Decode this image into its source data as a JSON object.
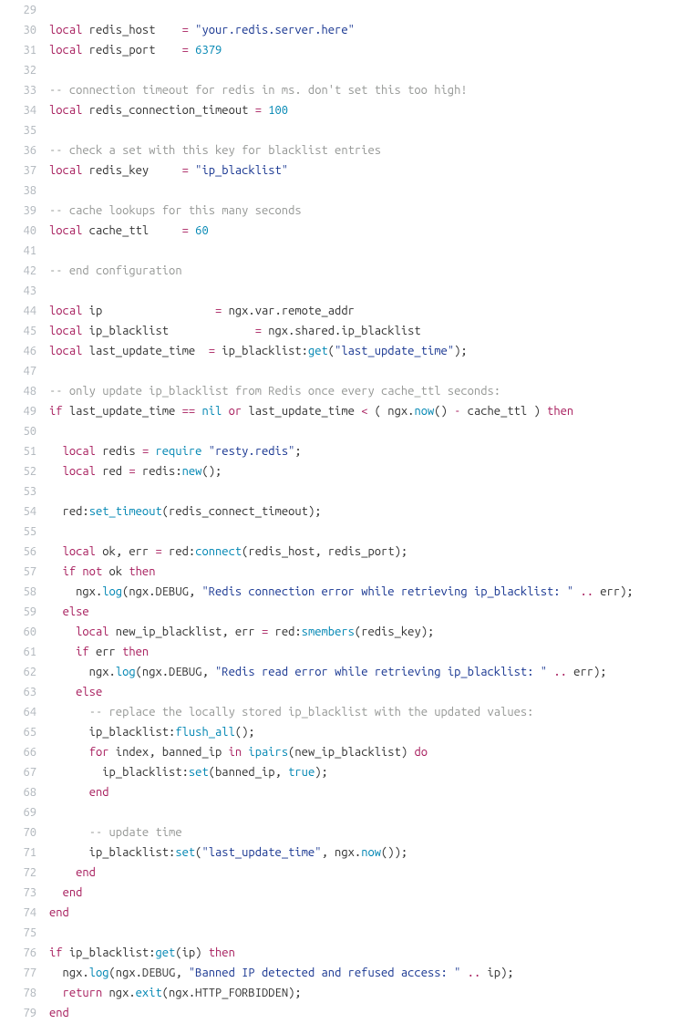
{
  "lines": [
    {
      "n": "29",
      "tokens": []
    },
    {
      "n": "30",
      "tokens": [
        {
          "c": "kw",
          "t": "local"
        },
        {
          "c": "id",
          "t": " redis_host    "
        },
        {
          "c": "kw",
          "t": "="
        },
        {
          "c": "id",
          "t": " "
        },
        {
          "c": "str",
          "t": "\"your.redis.server.here\""
        }
      ]
    },
    {
      "n": "31",
      "tokens": [
        {
          "c": "kw",
          "t": "local"
        },
        {
          "c": "id",
          "t": " redis_port    "
        },
        {
          "c": "kw",
          "t": "="
        },
        {
          "c": "id",
          "t": " "
        },
        {
          "c": "num",
          "t": "6379"
        }
      ]
    },
    {
      "n": "32",
      "tokens": []
    },
    {
      "n": "33",
      "tokens": [
        {
          "c": "cm",
          "t": "-- connection timeout for redis in ms. don't set this too high!"
        }
      ]
    },
    {
      "n": "34",
      "tokens": [
        {
          "c": "kw",
          "t": "local"
        },
        {
          "c": "id",
          "t": " redis_connection_timeout "
        },
        {
          "c": "kw",
          "t": "="
        },
        {
          "c": "id",
          "t": " "
        },
        {
          "c": "num",
          "t": "100"
        }
      ]
    },
    {
      "n": "35",
      "tokens": []
    },
    {
      "n": "36",
      "tokens": [
        {
          "c": "cm",
          "t": "-- check a set with this key for blacklist entries"
        }
      ]
    },
    {
      "n": "37",
      "tokens": [
        {
          "c": "kw",
          "t": "local"
        },
        {
          "c": "id",
          "t": " redis_key     "
        },
        {
          "c": "kw",
          "t": "="
        },
        {
          "c": "id",
          "t": " "
        },
        {
          "c": "str",
          "t": "\"ip_blacklist\""
        }
      ]
    },
    {
      "n": "38",
      "tokens": []
    },
    {
      "n": "39",
      "tokens": [
        {
          "c": "cm",
          "t": "-- cache lookups for this many seconds"
        }
      ]
    },
    {
      "n": "40",
      "tokens": [
        {
          "c": "kw",
          "t": "local"
        },
        {
          "c": "id",
          "t": " cache_ttl     "
        },
        {
          "c": "kw",
          "t": "="
        },
        {
          "c": "id",
          "t": " "
        },
        {
          "c": "num",
          "t": "60"
        }
      ]
    },
    {
      "n": "41",
      "tokens": []
    },
    {
      "n": "42",
      "tokens": [
        {
          "c": "cm",
          "t": "-- end configuration"
        }
      ]
    },
    {
      "n": "43",
      "tokens": []
    },
    {
      "n": "44",
      "tokens": [
        {
          "c": "kw",
          "t": "local"
        },
        {
          "c": "id",
          "t": " ip                 "
        },
        {
          "c": "kw",
          "t": "="
        },
        {
          "c": "id",
          "t": " ngx.var.remote_addr"
        }
      ]
    },
    {
      "n": "45",
      "tokens": [
        {
          "c": "kw",
          "t": "local"
        },
        {
          "c": "id",
          "t": " ip_blacklist             "
        },
        {
          "c": "kw",
          "t": "="
        },
        {
          "c": "id",
          "t": " ngx.shared.ip_blacklist"
        }
      ]
    },
    {
      "n": "46",
      "tokens": [
        {
          "c": "kw",
          "t": "local"
        },
        {
          "c": "id",
          "t": " last_update_time  "
        },
        {
          "c": "kw",
          "t": "="
        },
        {
          "c": "id",
          "t": " ip_blacklist:"
        },
        {
          "c": "fn",
          "t": "get"
        },
        {
          "c": "id",
          "t": "("
        },
        {
          "c": "str",
          "t": "\"last_update_time\""
        },
        {
          "c": "id",
          "t": ");"
        }
      ]
    },
    {
      "n": "47",
      "tokens": []
    },
    {
      "n": "48",
      "tokens": [
        {
          "c": "cm",
          "t": "-- only update ip_blacklist from Redis once every cache_ttl seconds:"
        }
      ]
    },
    {
      "n": "49",
      "tokens": [
        {
          "c": "kw",
          "t": "if"
        },
        {
          "c": "id",
          "t": " last_update_time "
        },
        {
          "c": "kw",
          "t": "=="
        },
        {
          "c": "id",
          "t": " "
        },
        {
          "c": "num",
          "t": "nil"
        },
        {
          "c": "id",
          "t": " "
        },
        {
          "c": "kw",
          "t": "or"
        },
        {
          "c": "id",
          "t": " last_update_time "
        },
        {
          "c": "kw",
          "t": "<"
        },
        {
          "c": "id",
          "t": " ( ngx."
        },
        {
          "c": "fn",
          "t": "now"
        },
        {
          "c": "id",
          "t": "() "
        },
        {
          "c": "kw",
          "t": "-"
        },
        {
          "c": "id",
          "t": " cache_ttl ) "
        },
        {
          "c": "kw",
          "t": "then"
        }
      ]
    },
    {
      "n": "50",
      "tokens": []
    },
    {
      "n": "51",
      "tokens": [
        {
          "c": "id",
          "t": "  "
        },
        {
          "c": "kw",
          "t": "local"
        },
        {
          "c": "id",
          "t": " redis "
        },
        {
          "c": "kw",
          "t": "="
        },
        {
          "c": "id",
          "t": " "
        },
        {
          "c": "fn",
          "t": "require"
        },
        {
          "c": "id",
          "t": " "
        },
        {
          "c": "str",
          "t": "\"resty.redis\""
        },
        {
          "c": "id",
          "t": ";"
        }
      ]
    },
    {
      "n": "52",
      "tokens": [
        {
          "c": "id",
          "t": "  "
        },
        {
          "c": "kw",
          "t": "local"
        },
        {
          "c": "id",
          "t": " red "
        },
        {
          "c": "kw",
          "t": "="
        },
        {
          "c": "id",
          "t": " redis:"
        },
        {
          "c": "fn",
          "t": "new"
        },
        {
          "c": "id",
          "t": "();"
        }
      ]
    },
    {
      "n": "53",
      "tokens": []
    },
    {
      "n": "54",
      "tokens": [
        {
          "c": "id",
          "t": "  red:"
        },
        {
          "c": "fn",
          "t": "set_timeout"
        },
        {
          "c": "id",
          "t": "(redis_connect_timeout);"
        }
      ]
    },
    {
      "n": "55",
      "tokens": []
    },
    {
      "n": "56",
      "tokens": [
        {
          "c": "id",
          "t": "  "
        },
        {
          "c": "kw",
          "t": "local"
        },
        {
          "c": "id",
          "t": " ok, err "
        },
        {
          "c": "kw",
          "t": "="
        },
        {
          "c": "id",
          "t": " red:"
        },
        {
          "c": "fn",
          "t": "connect"
        },
        {
          "c": "id",
          "t": "(redis_host, redis_port);"
        }
      ]
    },
    {
      "n": "57",
      "tokens": [
        {
          "c": "id",
          "t": "  "
        },
        {
          "c": "kw",
          "t": "if"
        },
        {
          "c": "id",
          "t": " "
        },
        {
          "c": "kw",
          "t": "not"
        },
        {
          "c": "id",
          "t": " ok "
        },
        {
          "c": "kw",
          "t": "then"
        }
      ]
    },
    {
      "n": "58",
      "tokens": [
        {
          "c": "id",
          "t": "    ngx."
        },
        {
          "c": "fn",
          "t": "log"
        },
        {
          "c": "id",
          "t": "(ngx.DEBUG, "
        },
        {
          "c": "str",
          "t": "\"Redis connection error while retrieving ip_blacklist: \""
        },
        {
          "c": "id",
          "t": " "
        },
        {
          "c": "kw",
          "t": ".."
        },
        {
          "c": "id",
          "t": " err);"
        }
      ]
    },
    {
      "n": "59",
      "tokens": [
        {
          "c": "id",
          "t": "  "
        },
        {
          "c": "kw",
          "t": "else"
        }
      ]
    },
    {
      "n": "60",
      "tokens": [
        {
          "c": "id",
          "t": "    "
        },
        {
          "c": "kw",
          "t": "local"
        },
        {
          "c": "id",
          "t": " new_ip_blacklist, err "
        },
        {
          "c": "kw",
          "t": "="
        },
        {
          "c": "id",
          "t": " red:"
        },
        {
          "c": "fn",
          "t": "smembers"
        },
        {
          "c": "id",
          "t": "(redis_key);"
        }
      ]
    },
    {
      "n": "61",
      "tokens": [
        {
          "c": "id",
          "t": "    "
        },
        {
          "c": "kw",
          "t": "if"
        },
        {
          "c": "id",
          "t": " err "
        },
        {
          "c": "kw",
          "t": "then"
        }
      ]
    },
    {
      "n": "62",
      "tokens": [
        {
          "c": "id",
          "t": "      ngx."
        },
        {
          "c": "fn",
          "t": "log"
        },
        {
          "c": "id",
          "t": "(ngx.DEBUG, "
        },
        {
          "c": "str",
          "t": "\"Redis read error while retrieving ip_blacklist: \""
        },
        {
          "c": "id",
          "t": " "
        },
        {
          "c": "kw",
          "t": ".."
        },
        {
          "c": "id",
          "t": " err);"
        }
      ]
    },
    {
      "n": "63",
      "tokens": [
        {
          "c": "id",
          "t": "    "
        },
        {
          "c": "kw",
          "t": "else"
        }
      ]
    },
    {
      "n": "64",
      "tokens": [
        {
          "c": "id",
          "t": "      "
        },
        {
          "c": "cm",
          "t": "-- replace the locally stored ip_blacklist with the updated values:"
        }
      ]
    },
    {
      "n": "65",
      "tokens": [
        {
          "c": "id",
          "t": "      ip_blacklist:"
        },
        {
          "c": "fn",
          "t": "flush_all"
        },
        {
          "c": "id",
          "t": "();"
        }
      ]
    },
    {
      "n": "66",
      "tokens": [
        {
          "c": "id",
          "t": "      "
        },
        {
          "c": "kw",
          "t": "for"
        },
        {
          "c": "id",
          "t": " index, banned_ip "
        },
        {
          "c": "kw",
          "t": "in"
        },
        {
          "c": "id",
          "t": " "
        },
        {
          "c": "fn",
          "t": "ipairs"
        },
        {
          "c": "id",
          "t": "(new_ip_blacklist) "
        },
        {
          "c": "kw",
          "t": "do"
        }
      ]
    },
    {
      "n": "67",
      "tokens": [
        {
          "c": "id",
          "t": "        ip_blacklist:"
        },
        {
          "c": "fn",
          "t": "set"
        },
        {
          "c": "id",
          "t": "(banned_ip, "
        },
        {
          "c": "num",
          "t": "true"
        },
        {
          "c": "id",
          "t": ");"
        }
      ]
    },
    {
      "n": "68",
      "tokens": [
        {
          "c": "id",
          "t": "      "
        },
        {
          "c": "kw",
          "t": "end"
        }
      ]
    },
    {
      "n": "69",
      "tokens": []
    },
    {
      "n": "70",
      "tokens": [
        {
          "c": "id",
          "t": "      "
        },
        {
          "c": "cm",
          "t": "-- update time"
        }
      ]
    },
    {
      "n": "71",
      "tokens": [
        {
          "c": "id",
          "t": "      ip_blacklist:"
        },
        {
          "c": "fn",
          "t": "set"
        },
        {
          "c": "id",
          "t": "("
        },
        {
          "c": "str",
          "t": "\"last_update_time\""
        },
        {
          "c": "id",
          "t": ", ngx."
        },
        {
          "c": "fn",
          "t": "now"
        },
        {
          "c": "id",
          "t": "());"
        }
      ]
    },
    {
      "n": "72",
      "tokens": [
        {
          "c": "id",
          "t": "    "
        },
        {
          "c": "kw",
          "t": "end"
        }
      ]
    },
    {
      "n": "73",
      "tokens": [
        {
          "c": "id",
          "t": "  "
        },
        {
          "c": "kw",
          "t": "end"
        }
      ]
    },
    {
      "n": "74",
      "tokens": [
        {
          "c": "kw",
          "t": "end"
        }
      ]
    },
    {
      "n": "75",
      "tokens": []
    },
    {
      "n": "76",
      "tokens": [
        {
          "c": "kw",
          "t": "if"
        },
        {
          "c": "id",
          "t": " ip_blacklist:"
        },
        {
          "c": "fn",
          "t": "get"
        },
        {
          "c": "id",
          "t": "(ip) "
        },
        {
          "c": "kw",
          "t": "then"
        }
      ]
    },
    {
      "n": "77",
      "tokens": [
        {
          "c": "id",
          "t": "  ngx."
        },
        {
          "c": "fn",
          "t": "log"
        },
        {
          "c": "id",
          "t": "(ngx.DEBUG, "
        },
        {
          "c": "str",
          "t": "\"Banned IP detected and refused access: \""
        },
        {
          "c": "id",
          "t": " "
        },
        {
          "c": "kw",
          "t": ".."
        },
        {
          "c": "id",
          "t": " ip);"
        }
      ]
    },
    {
      "n": "78",
      "tokens": [
        {
          "c": "id",
          "t": "  "
        },
        {
          "c": "kw",
          "t": "return"
        },
        {
          "c": "id",
          "t": " ngx."
        },
        {
          "c": "fn",
          "t": "exit"
        },
        {
          "c": "id",
          "t": "(ngx.HTTP_FORBIDDEN);"
        }
      ]
    },
    {
      "n": "79",
      "tokens": [
        {
          "c": "kw",
          "t": "end"
        }
      ]
    }
  ]
}
